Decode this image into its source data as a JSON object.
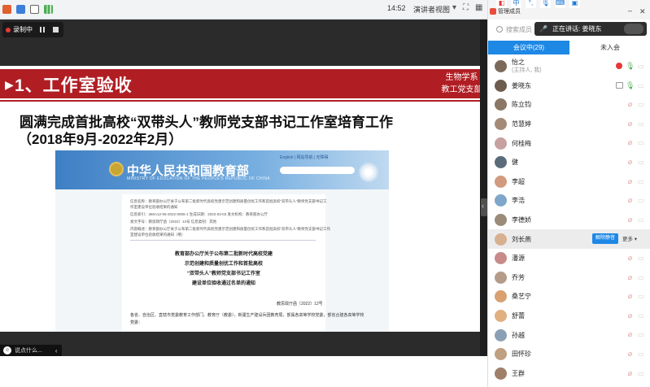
{
  "topbar": {
    "time": "14:52",
    "presenter_view": "演讲者视图",
    "icons": [
      "app-logo-icon",
      "shield-icon",
      "panel-icon",
      "signal-icon"
    ]
  },
  "recording": {
    "label": "录制中"
  },
  "slide": {
    "header": "1、工作室验收",
    "side_badge_line1": "生物学系",
    "side_badge_line2": "教工党支部",
    "title": "圆满完成首批高校“双带头人”教师党支部书记工作室培育工作",
    "subtitle": "（2018年9月-2022年2月）",
    "moe": {
      "name": "中华人民共和国教育部",
      "name_en": "MINISTRY OF EDUCATION OF THE PEOPLE'S REPUBLIC OF CHINA",
      "top_links": "English  |  网站导航  |  无障碍",
      "meta": [
        "信息名称：教育部办公厅关于公布第二批新时代高校党建示范创建和质量创优工作和首批高校“双带头人”教师党支部书记工",
        "             作室建设单位验收结果的通知",
        "信息索引：360A12-06-2022-0005-1   生成日期：2022-03-03         发文机构：教育部办公厅",
        "发文字号：教思政厅函〔2022〕12号   信息类别：其他",
        "内容概述：教育部办公厅关于公布第二批新时代高校党建示范创建和质量创优工作和首批高校“双带头人”教师党支部书记工作",
        "             室建设单位验收结果的通知（略）"
      ],
      "heading": [
        "教育部办公厅关于公布第二批新时代高校党建",
        "示范创建和质量创优工作和首批高校",
        "“双带头人”教师党支部书记工作室",
        "建设单位验收通过名单的通知"
      ],
      "doc_no": "教思政厅函〔2022〕12号",
      "body": [
        "各省、自治区、直辖市党委教育工作部门、教育厅（教委），新疆生产建设兵团教育局，部属各高等学校党委，部省合建各高等学校",
        "党委："
      ]
    }
  },
  "chat": {
    "placeholder": "说点什么..."
  },
  "panel": {
    "title": "管理成员",
    "search_placeholder": "搜索成员",
    "speaking": "正在讲话: 姜晓东",
    "tabs": [
      "会议中(29)",
      "未入会"
    ],
    "unmute_all": "解除静音",
    "more": "更多 ▾",
    "members": [
      {
        "name": "怡之",
        "sub": "(主持人, 我)",
        "color": "#7b6a5a"
      },
      {
        "name": "姜晓东",
        "color": "#6d5d4e"
      },
      {
        "name": "陈立钧",
        "color": "#8a7766"
      },
      {
        "name": "范慧婷",
        "color": "#a58b76"
      },
      {
        "name": "何桂梅",
        "color": "#c9a0a0"
      },
      {
        "name": "健",
        "color": "#5b6b7a"
      },
      {
        "name": "李超",
        "color": "#d29a7e"
      },
      {
        "name": "李浩",
        "color": "#7fa7c9"
      },
      {
        "name": "李德娇",
        "color": "#9a8b7a"
      },
      {
        "name": "刘长燕",
        "color": "#d7b08f"
      },
      {
        "name": "潘源",
        "color": "#c98a8a"
      },
      {
        "name": "乔芳",
        "color": "#b59b8a"
      },
      {
        "name": "桑艺宁",
        "color": "#d9a070"
      },
      {
        "name": "舒蕾",
        "color": "#e0b080"
      },
      {
        "name": "孙越",
        "color": "#8aa0b5"
      },
      {
        "name": "田怀珍",
        "color": "#c0a080"
      },
      {
        "name": "王群",
        "color": "#a07f6a"
      }
    ]
  }
}
